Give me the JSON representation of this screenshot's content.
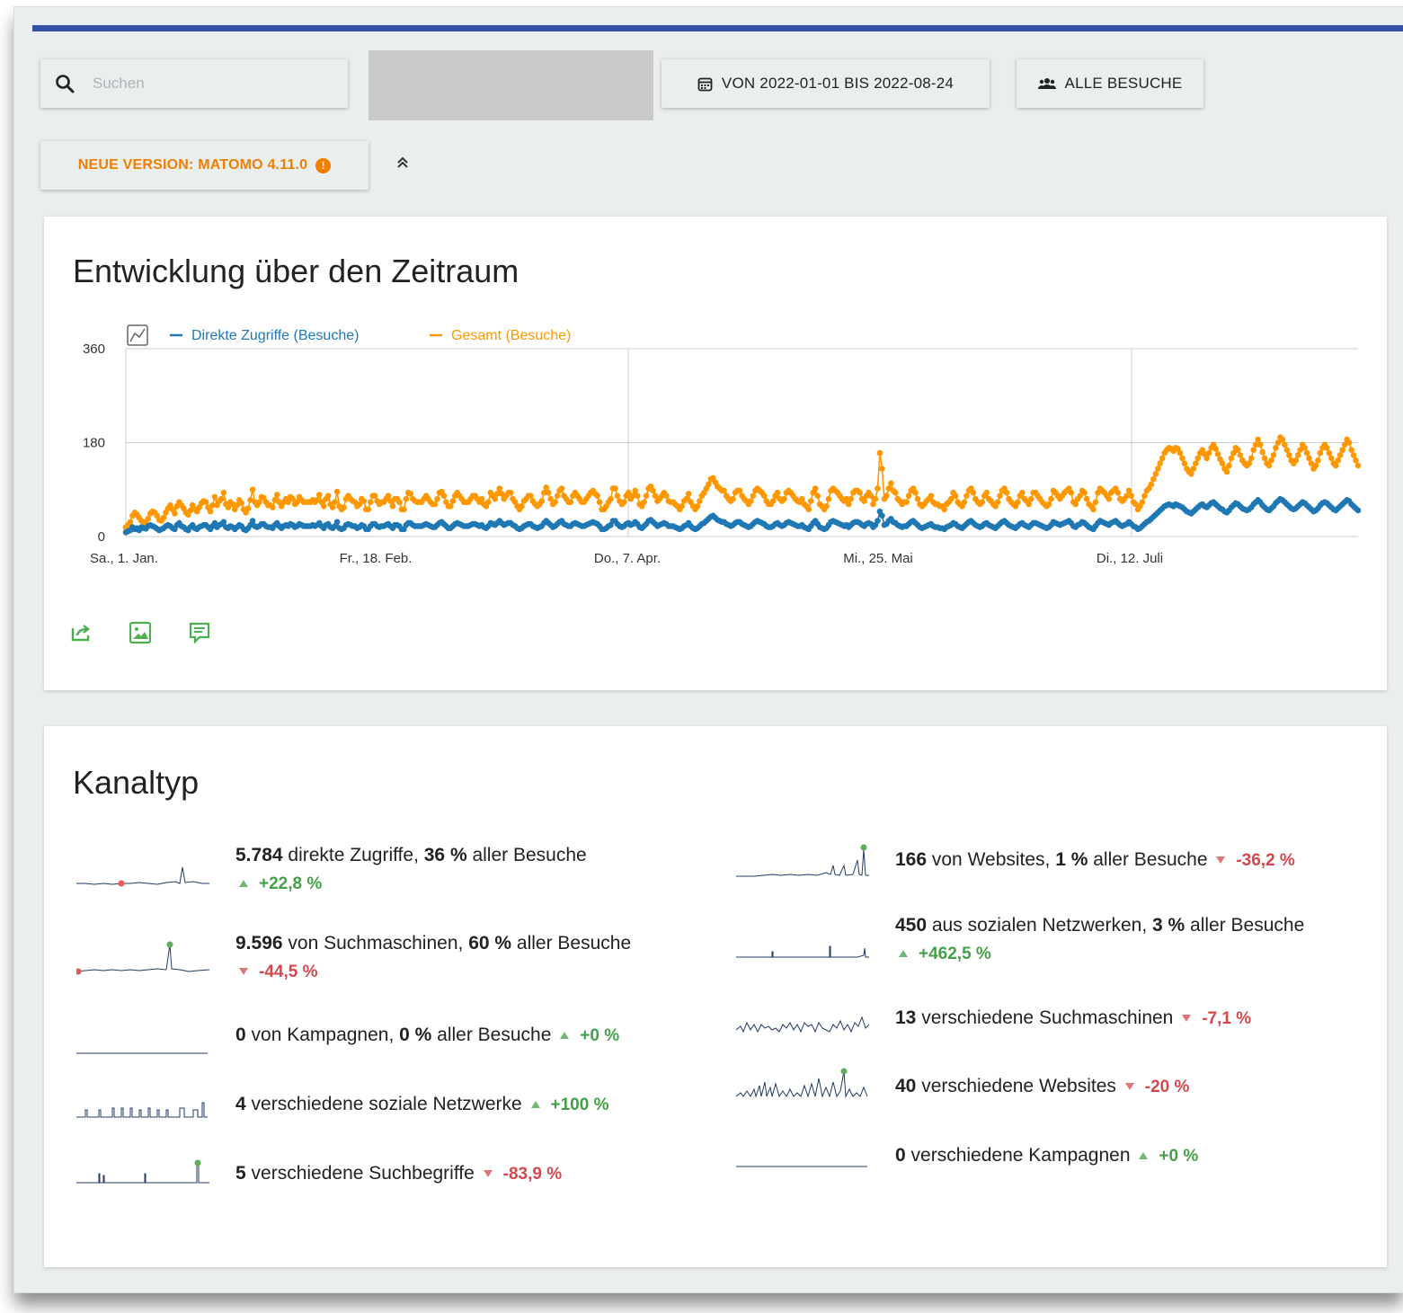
{
  "toolbar": {
    "search_placeholder": "Suchen",
    "date_range_label": "VON 2022-01-01 BIS 2022-08-24",
    "segment_label": "ALLE BESUCHE",
    "new_version_label": "NEUE VERSION: MATOMO 4.11.0",
    "collapse_glyph": "≈"
  },
  "evolution": {
    "title": "Entwicklung über den Zeitraum",
    "icons": [
      "export-icon",
      "image-icon",
      "annotation-icon"
    ]
  },
  "chart_data": {
    "type": "line",
    "x_start": "2022-01-01",
    "x_end": "2022-08-24",
    "x_ticks": [
      "Sa., 1. Jan.",
      "Fr., 18. Feb.",
      "Do., 7. Apr.",
      "Mi., 25. Mai",
      "Di., 12. Juli"
    ],
    "y_ticks": [
      "0",
      "180",
      "360"
    ],
    "ylim": [
      0,
      360
    ],
    "grid": true,
    "legend_position": "top-left",
    "series": [
      {
        "name": "Direkte Zugriffe (Besuche)",
        "color": "#1f78b4",
        "values": [
          8,
          10,
          12,
          18,
          14,
          16,
          12,
          18,
          16,
          15,
          20,
          22,
          20,
          18,
          15,
          12,
          14,
          16,
          20,
          22,
          20,
          16,
          14,
          22,
          26,
          20,
          18,
          14,
          12,
          18,
          22,
          16,
          14,
          18,
          20,
          22,
          22,
          18,
          14,
          20,
          26,
          18,
          22,
          24,
          28,
          18,
          16,
          20,
          18,
          14,
          18,
          22,
          20,
          14,
          12,
          16,
          22,
          30,
          20,
          18,
          20,
          24,
          24,
          20,
          18,
          18,
          16,
          22,
          26,
          20,
          16,
          20,
          22,
          20,
          24,
          22,
          18,
          20,
          24,
          22,
          20,
          20,
          20,
          20,
          22,
          20,
          22,
          26,
          20,
          16,
          22,
          24,
          18,
          16,
          20,
          28,
          16,
          14,
          16,
          22,
          24,
          22,
          20,
          20,
          16,
          18,
          22,
          20,
          14,
          14,
          20,
          24,
          24,
          20,
          18,
          20,
          20,
          22,
          24,
          20,
          16,
          22,
          22,
          20,
          14,
          14,
          22,
          26,
          26,
          22,
          20,
          20,
          20,
          20,
          22,
          24,
          22,
          20,
          18,
          18,
          22,
          26,
          28,
          24,
          20,
          16,
          16,
          20,
          24,
          26,
          24,
          22,
          20,
          20,
          20,
          22,
          24,
          24,
          22,
          20,
          22,
          18,
          16,
          20,
          26,
          24,
          22,
          26,
          30,
          26,
          22,
          24,
          26,
          26,
          22,
          20,
          16,
          14,
          16,
          20,
          22,
          24,
          24,
          20,
          18,
          16,
          18,
          20,
          26,
          30,
          26,
          22,
          18,
          20,
          24,
          28,
          30,
          24,
          22,
          20,
          20,
          24,
          26,
          24,
          22,
          20,
          20,
          22,
          24,
          26,
          28,
          26,
          24,
          20,
          14,
          14,
          16,
          20,
          22,
          30,
          30,
          24,
          20,
          18,
          20,
          24,
          26,
          22,
          24,
          28,
          24,
          18,
          16,
          20,
          24,
          30,
          32,
          28,
          24,
          20,
          22,
          24,
          26,
          24,
          20,
          20,
          20,
          18,
          16,
          14,
          16,
          20,
          22,
          26,
          20,
          16,
          14,
          16,
          20,
          24,
          26,
          30,
          34,
          38,
          40,
          36,
          32,
          30,
          28,
          28,
          24,
          22,
          20,
          22,
          26,
          28,
          28,
          24,
          22,
          20,
          18,
          20,
          24,
          28,
          30,
          28,
          26,
          24,
          20,
          18,
          18,
          20,
          24,
          26,
          22,
          20,
          22,
          26,
          28,
          26,
          24,
          22,
          20,
          20,
          22,
          18,
          16,
          14,
          20,
          26,
          30,
          24,
          18,
          16,
          14,
          16,
          22,
          28,
          30,
          28,
          26,
          24,
          22,
          20,
          22,
          18,
          22,
          26,
          28,
          28,
          26,
          22,
          20,
          24,
          26,
          24,
          18,
          22,
          30,
          48,
          40,
          22,
          24,
          30,
          34,
          28,
          26,
          22,
          20,
          18,
          20,
          20,
          24,
          28,
          30,
          26,
          22,
          18,
          16,
          18,
          20,
          22,
          24,
          20,
          18,
          18,
          16,
          16,
          14,
          18,
          20,
          22,
          26,
          24,
          20,
          18,
          16,
          20,
          24,
          28,
          30,
          26,
          22,
          20,
          18,
          20,
          24,
          26,
          22,
          20,
          18,
          16,
          20,
          24,
          28,
          30,
          26,
          22,
          20,
          18,
          16,
          20,
          24,
          26,
          22,
          20,
          18,
          22,
          26,
          26,
          24,
          22,
          20,
          18,
          16,
          18,
          22,
          28,
          26,
          24,
          22,
          24,
          26,
          28,
          30,
          26,
          20,
          18,
          22,
          24,
          28,
          26,
          22,
          18,
          16,
          14,
          20,
          26,
          30,
          28,
          26,
          24,
          22,
          26,
          28,
          30,
          26,
          22,
          20,
          22,
          24,
          28,
          24,
          20,
          18,
          14,
          16,
          20,
          24,
          28,
          30,
          34,
          38,
          42,
          46,
          50,
          54,
          58,
          60,
          62,
          60,
          58,
          62,
          60,
          58,
          56,
          52,
          48,
          46,
          44,
          48,
          52,
          56,
          60,
          62,
          58,
          56,
          60,
          64,
          66,
          62,
          58,
          54,
          52,
          48,
          46,
          50,
          56,
          60,
          64,
          62,
          58,
          54,
          52,
          50,
          52,
          56,
          62,
          66,
          70,
          66,
          60,
          56,
          52,
          50,
          54,
          58,
          64,
          68,
          72,
          70,
          66,
          62,
          58,
          54,
          52,
          54,
          58,
          62,
          66,
          64,
          60,
          56,
          52,
          48,
          50,
          54,
          60,
          64,
          66,
          64,
          60,
          56,
          52,
          50,
          54,
          58,
          62,
          66,
          70,
          68,
          62,
          58,
          54,
          50
        ]
      },
      {
        "name": "Gesamt (Besuche)",
        "color": "#ff9800",
        "values": [
          18,
          22,
          28,
          40,
          46,
          42,
          36,
          30,
          28,
          24,
          34,
          44,
          48,
          46,
          40,
          32,
          30,
          36,
          46,
          54,
          60,
          52,
          44,
          58,
          66,
          60,
          54,
          46,
          42,
          50,
          60,
          52,
          48,
          56,
          64,
          68,
          66,
          56,
          48,
          60,
          76,
          60,
          68,
          72,
          84,
          62,
          56,
          66,
          62,
          52,
          60,
          70,
          64,
          52,
          46,
          54,
          70,
          90,
          66,
          60,
          66,
          76,
          74,
          66,
          60,
          60,
          56,
          70,
          80,
          66,
          58,
          66,
          72,
          66,
          76,
          72,
          62,
          66,
          76,
          70,
          66,
          66,
          66,
          66,
          70,
          66,
          70,
          80,
          66,
          58,
          72,
          78,
          62,
          56,
          66,
          86,
          58,
          52,
          56,
          72,
          78,
          72,
          68,
          66,
          58,
          62,
          72,
          68,
          52,
          52,
          66,
          78,
          78,
          68,
          62,
          66,
          66,
          72,
          78,
          68,
          58,
          72,
          72,
          66,
          52,
          52,
          72,
          84,
          82,
          72,
          68,
          66,
          66,
          66,
          72,
          78,
          72,
          66,
          62,
          62,
          72,
          84,
          86,
          78,
          66,
          58,
          58,
          68,
          78,
          84,
          78,
          72,
          66,
          66,
          66,
          72,
          78,
          78,
          72,
          66,
          72,
          62,
          58,
          66,
          84,
          78,
          72,
          82,
          92,
          82,
          72,
          78,
          84,
          84,
          72,
          66,
          58,
          52,
          58,
          68,
          72,
          78,
          78,
          68,
          62,
          58,
          62,
          68,
          84,
          94,
          84,
          72,
          62,
          66,
          78,
          88,
          92,
          78,
          72,
          66,
          66,
          78,
          84,
          78,
          72,
          66,
          66,
          72,
          78,
          84,
          88,
          82,
          78,
          66,
          52,
          52,
          58,
          66,
          72,
          92,
          92,
          78,
          68,
          62,
          66,
          78,
          84,
          72,
          78,
          88,
          78,
          62,
          58,
          66,
          78,
          92,
          96,
          88,
          78,
          68,
          72,
          78,
          84,
          78,
          68,
          66,
          66,
          62,
          58,
          52,
          58,
          68,
          72,
          82,
          66,
          58,
          52,
          58,
          68,
          78,
          84,
          92,
          100,
          110,
          112,
          104,
          96,
          92,
          88,
          88,
          78,
          72,
          68,
          72,
          84,
          88,
          88,
          78,
          72,
          68,
          62,
          68,
          78,
          88,
          92,
          88,
          84,
          78,
          68,
          62,
          62,
          68,
          78,
          84,
          72,
          68,
          72,
          84,
          88,
          84,
          78,
          72,
          68,
          66,
          72,
          62,
          58,
          52,
          68,
          84,
          92,
          78,
          62,
          58,
          52,
          58,
          72,
          88,
          92,
          88,
          84,
          78,
          72,
          68,
          72,
          62,
          72,
          84,
          88,
          88,
          84,
          72,
          68,
          78,
          84,
          78,
          62,
          72,
          92,
          160,
          130,
          72,
          78,
          92,
          102,
          88,
          84,
          72,
          68,
          62,
          66,
          66,
          78,
          88,
          92,
          84,
          72,
          62,
          58,
          62,
          68,
          72,
          78,
          66,
          62,
          62,
          58,
          58,
          52,
          62,
          66,
          72,
          84,
          78,
          66,
          62,
          58,
          66,
          78,
          88,
          92,
          84,
          72,
          66,
          62,
          66,
          78,
          84,
          72,
          68,
          62,
          58,
          66,
          78,
          88,
          92,
          84,
          72,
          66,
          62,
          58,
          66,
          78,
          84,
          72,
          68,
          62,
          72,
          84,
          84,
          78,
          72,
          66,
          62,
          58,
          62,
          72,
          88,
          84,
          78,
          72,
          78,
          84,
          88,
          92,
          84,
          66,
          62,
          72,
          78,
          88,
          84,
          72,
          62,
          58,
          52,
          66,
          84,
          92,
          88,
          84,
          78,
          72,
          84,
          88,
          92,
          84,
          72,
          68,
          72,
          78,
          88,
          78,
          66,
          62,
          52,
          58,
          66,
          78,
          88,
          92,
          100,
          110,
          120,
          130,
          140,
          150,
          160,
          166,
          170,
          168,
          164,
          170,
          168,
          160,
          150,
          140,
          130,
          124,
          120,
          130,
          140,
          150,
          160,
          166,
          158,
          150,
          160,
          170,
          176,
          168,
          158,
          148,
          140,
          130,
          124,
          136,
          150,
          160,
          170,
          166,
          156,
          146,
          140,
          136,
          140,
          150,
          166,
          176,
          186,
          176,
          162,
          150,
          140,
          136,
          146,
          156,
          170,
          180,
          190,
          186,
          176,
          166,
          156,
          146,
          140,
          146,
          156,
          166,
          176,
          170,
          160,
          150,
          140,
          130,
          136,
          146,
          160,
          170,
          176,
          170,
          160,
          150,
          140,
          136,
          146,
          156,
          166,
          176,
          186,
          180,
          166,
          156,
          146,
          136
        ]
      }
    ]
  },
  "kanaltyp": {
    "title": "Kanaltyp",
    "left": [
      {
        "num": "5.784",
        "mid": " direkte Zugriffe, ",
        "pct": "36 %",
        "suf": " aller Besuche",
        "change": "+22,8 %",
        "dir": "up"
      },
      {
        "num": "9.596",
        "mid": " von Suchmaschinen, ",
        "pct": "60 %",
        "suf": " aller Besuche",
        "change": "-44,5 %",
        "dir": "down"
      },
      {
        "num": "0",
        "mid": " von Kampagnen, ",
        "pct": "0 %",
        "suf": " aller Besuche",
        "change": "+0 %",
        "dir": "up"
      },
      {
        "num": "4",
        "mid": " verschiedene soziale Netzwerke",
        "pct": "",
        "suf": "",
        "change": "+100 %",
        "dir": "up"
      },
      {
        "num": "5",
        "mid": " verschiedene Suchbegriffe",
        "pct": "",
        "suf": "",
        "change": "-83,9 %",
        "dir": "down"
      }
    ],
    "right": [
      {
        "num": "166",
        "mid": " von Websites, ",
        "pct": "1 %",
        "suf": " aller Besuche",
        "change": "-36,2 %",
        "dir": "down"
      },
      {
        "num": "450",
        "mid": " aus sozialen Netzwerken, ",
        "pct": "3 %",
        "suf": " aller Besuche",
        "change": "+462,5 %",
        "dir": "up"
      },
      {
        "num": "13",
        "mid": " verschiedene Suchmaschinen",
        "pct": "",
        "suf": "",
        "change": "-7,1 %",
        "dir": "down"
      },
      {
        "num": "40",
        "mid": " verschiedene Websites",
        "pct": "",
        "suf": "",
        "change": "-20 %",
        "dir": "down"
      },
      {
        "num": "0",
        "mid": " verschiedene Kampagnen",
        "pct": "",
        "suf": "",
        "change": "+0 %",
        "dir": "up"
      }
    ]
  }
}
